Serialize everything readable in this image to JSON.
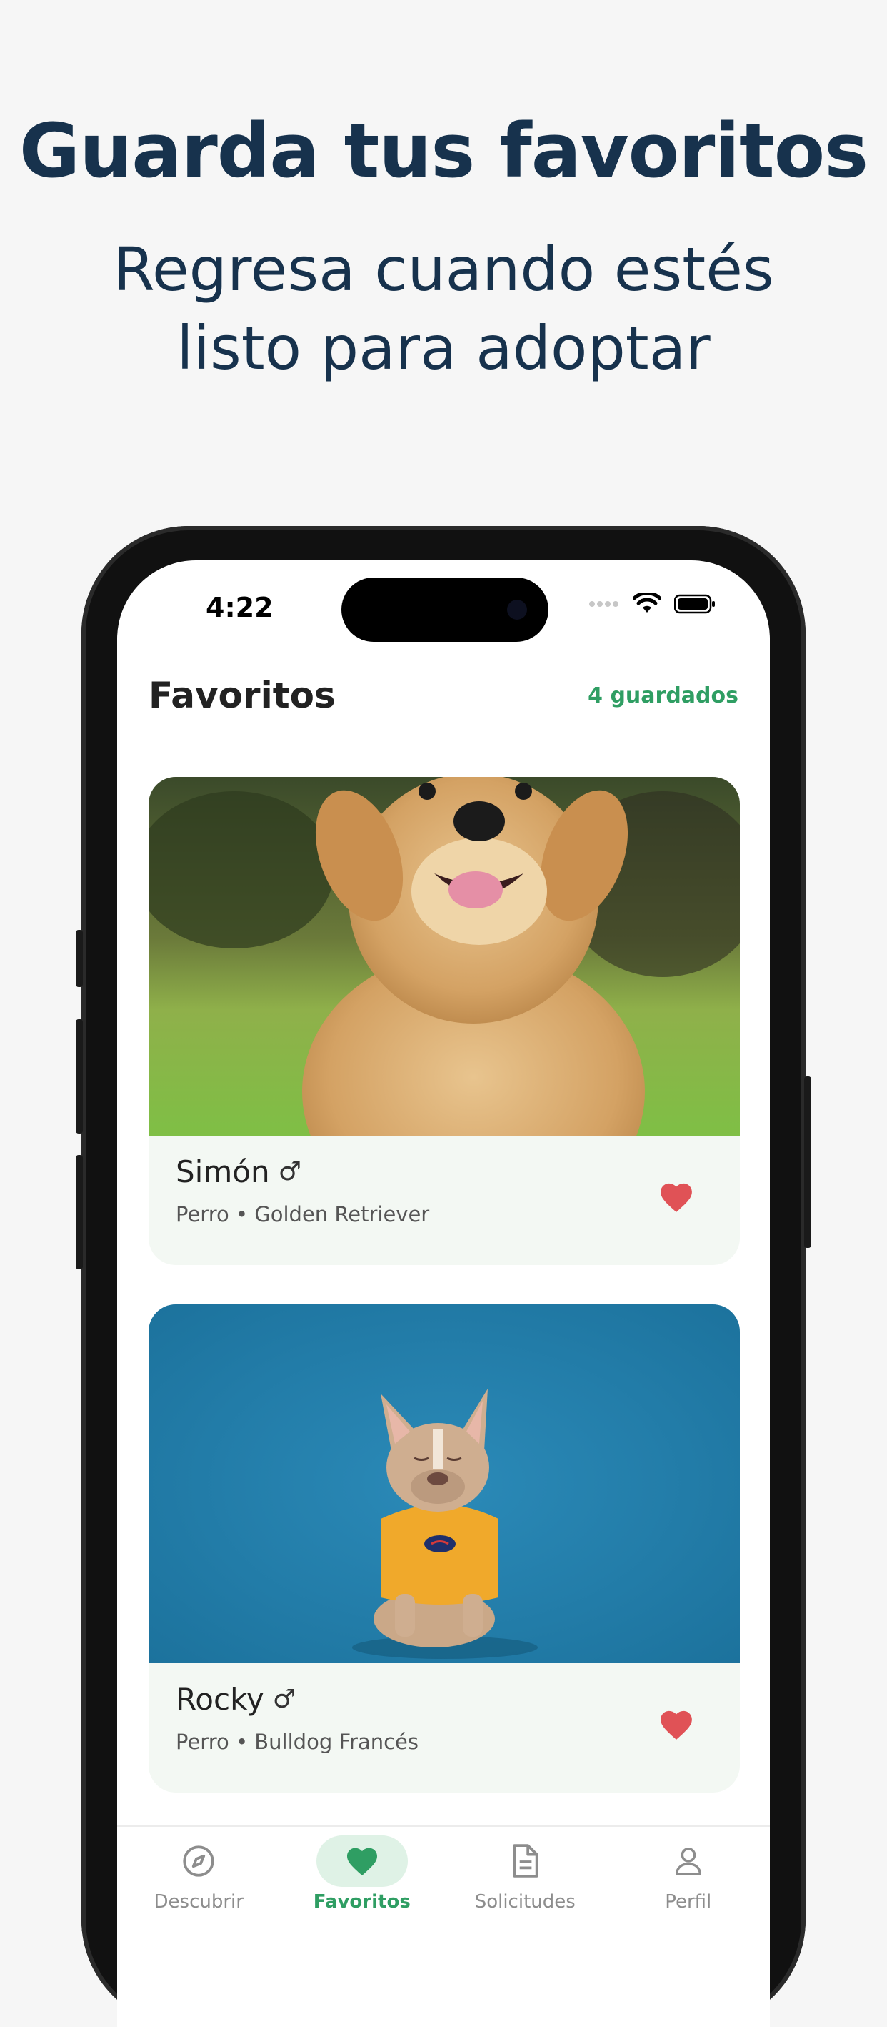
{
  "promo": {
    "title": "Guarda tus favoritos",
    "subtitle_line1": "Regresa cuando estés",
    "subtitle_line2": "listo para adoptar"
  },
  "status_bar": {
    "time": "4:22"
  },
  "header": {
    "title": "Favoritos",
    "saved_count": "4 guardados"
  },
  "favorites": [
    {
      "name": "Simón",
      "gender_symbol": "♂",
      "meta": "Perro • Golden Retriever",
      "photo": "golden-retriever-photo",
      "favorited": true
    },
    {
      "name": "Rocky",
      "gender_symbol": "♂",
      "meta": "Perro • Bulldog Francés",
      "photo": "french-bulldog-photo",
      "favorited": true
    }
  ],
  "tabs": [
    {
      "label": "Descubrir",
      "icon": "compass-icon",
      "active": false
    },
    {
      "label": "Favoritos",
      "icon": "heart-icon",
      "active": true
    },
    {
      "label": "Solicitudes",
      "icon": "document-icon",
      "active": false
    },
    {
      "label": "Perfil",
      "icon": "user-icon",
      "active": false
    }
  ],
  "colors": {
    "accent": "#2f9e63",
    "heart": "#e05256",
    "headline": "#17324d",
    "card_bg": "#f3f8f3"
  }
}
